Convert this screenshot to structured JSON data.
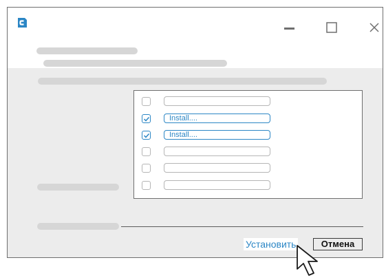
{
  "window": {
    "brand_color": "#2b86c5",
    "logo_icon": "app-logo-icon",
    "controls": [
      "minimize-icon",
      "maximize-icon",
      "close-icon"
    ]
  },
  "list": {
    "rows": [
      {
        "checked": false,
        "value": ""
      },
      {
        "checked": true,
        "value": "Install...."
      },
      {
        "checked": true,
        "value": "Install...."
      },
      {
        "checked": false,
        "value": ""
      },
      {
        "checked": false,
        "value": ""
      },
      {
        "checked": false,
        "value": ""
      }
    ]
  },
  "footer": {
    "install_label": "Установить",
    "cancel_label": "Отмена"
  },
  "colors": {
    "accent": "#2b86c5",
    "placeholder": "#d6d6d6",
    "panel_bg": "#ececec"
  }
}
